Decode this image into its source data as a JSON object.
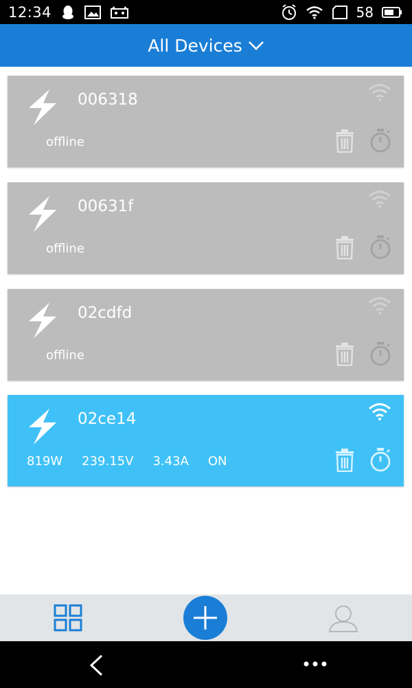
{
  "status_bar": {
    "time": "12:34",
    "battery": "58"
  },
  "header": {
    "title": "All Devices"
  },
  "devices": [
    {
      "name": "006318",
      "status": "offline"
    },
    {
      "name": "00631f",
      "status": "offline"
    },
    {
      "name": "02cdfd",
      "status": "offline"
    },
    {
      "name": "02ce14",
      "power": "819W",
      "voltage": "239.15V",
      "current": "3.43A",
      "state": "ON"
    }
  ],
  "colors": {
    "primary": "#1a7ed6",
    "card_offline": "#bcbcbc",
    "card_online": "#3fc1f7",
    "nav_bg": "#e1e5e7"
  },
  "icons": {
    "device": "lightning-bolt-icon",
    "delete": "trash-icon",
    "schedule": "stopwatch-icon",
    "signal": "wifi-icon"
  }
}
